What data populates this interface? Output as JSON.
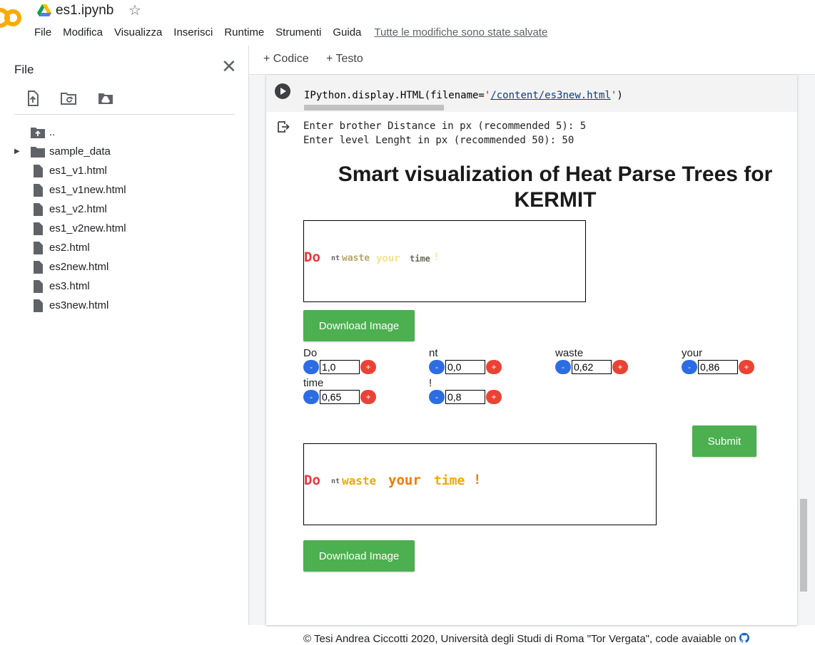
{
  "header": {
    "notebook_title": "es1.ipynb",
    "menu": [
      "File",
      "Modifica",
      "Visualizza",
      "Inserisci",
      "Runtime",
      "Strumenti",
      "Guida"
    ],
    "save_status": "Tutte le modifiche sono state salvate"
  },
  "sidebar": {
    "title": "File",
    "tools": [
      "upload-icon",
      "refresh-folder-icon",
      "mount-drive-icon"
    ],
    "items": [
      {
        "label": "..",
        "type": "folder-up"
      },
      {
        "label": "sample_data",
        "type": "folder"
      },
      {
        "label": "es1_v1.html",
        "type": "file"
      },
      {
        "label": "es1_v1new.html",
        "type": "file"
      },
      {
        "label": "es1_v2.html",
        "type": "file"
      },
      {
        "label": "es1_v2new.html",
        "type": "file"
      },
      {
        "label": "es2.html",
        "type": "file"
      },
      {
        "label": "es2new.html",
        "type": "file"
      },
      {
        "label": "es3.html",
        "type": "file"
      },
      {
        "label": "es3new.html",
        "type": "file"
      }
    ]
  },
  "toolbar": {
    "code_label": "+ Codice",
    "text_label": "+ Testo"
  },
  "cell": {
    "code_prefix": "IPython.display.HTML(filename=",
    "code_quote_open": "'",
    "code_string": "/content/es3new.html",
    "code_quote_close": "'",
    "code_suffix": ")",
    "console_lines": [
      "Enter brother Distance in px (recommended 5): 5",
      "Enter level Lenght in px (recommended 50): 50"
    ]
  },
  "output": {
    "title": "Smart visualization of Heat Parse Trees for KERMIT",
    "viz1_words": [
      {
        "text": "Do",
        "color": "#e53935"
      },
      {
        "text": "nt",
        "color": "#666666"
      },
      {
        "text": "waste",
        "color": "#b3a86a"
      },
      {
        "text": "your",
        "color": "#f2e48a"
      },
      {
        "text": "time",
        "color": "#6b6a5a"
      },
      {
        "text": "!",
        "color": "#f3e8a0"
      }
    ],
    "viz2_words": [
      {
        "text": "Do",
        "color": "#e53935"
      },
      {
        "text": "nt",
        "color": "#666666"
      },
      {
        "text": "waste",
        "color": "#f2a900"
      },
      {
        "text": "your",
        "color": "#f07a00"
      },
      {
        "text": "time",
        "color": "#f2a900"
      },
      {
        "text": "!",
        "color": "#f07a00"
      }
    ],
    "download_label": "Download Image",
    "controls": [
      {
        "label": "Do",
        "value": "1,0"
      },
      {
        "label": "nt",
        "value": "0,0"
      },
      {
        "label": "waste",
        "value": "0,62"
      },
      {
        "label": "your",
        "value": "0,86"
      },
      {
        "label": "time",
        "value": "0,65"
      },
      {
        "label": "!",
        "value": "0,8"
      }
    ],
    "minus_label": "-",
    "plus_label": "+",
    "submit_label": "Submit",
    "footer": "© Tesi Andrea Ciccotti 2020, Università degli Studi di Roma \"Tor Vergata\", code avaiable on"
  },
  "colors": {
    "accent_green": "#4caf50",
    "minus_blue": "#2d6de3",
    "plus_red": "#ea4335",
    "logo_orange": "#f9ab00"
  }
}
